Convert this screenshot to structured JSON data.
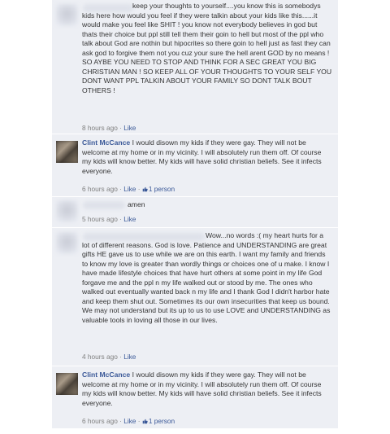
{
  "comments": [
    {
      "author": "",
      "text": "keep your thoughts to yourself....you know this is somebodys kids here how would you feel if they were talkin about your kids like this......it would make you feel like SHIT ! you know not everybody believes in god but thats their choice but ppl still tell them their goin to hell but most of the ppl who talk about God are nothin but hipocrites so there goin to hell just as fast they can ask god to forgive them not you cuz your sure the hell arent GOD by no means ! SO AYBE YOU NEED TO STOP AND THINK FOR A SEC GREAT YOU BIG CHRISTIAN MAN ! SO KEEP ALL OF YOUR THOUGHTS TO YOUR SELF YOU DONT WANT PPL TALKIN ABOUT YOUR FAMILY SO DONT TALK BOUT OTHERS !",
      "time": "8 hours ago",
      "like": "Like"
    },
    {
      "author": "Clint McCance",
      "text": "I would disown my kids if they were gay. They will not be welcome at my home or in my vicinity. I will absolutely run them off. Of course my kids will know better. My kids will have solid christian beliefs. See it infects everyone.",
      "time": "6 hours ago",
      "like": "Like",
      "likes_count": "1 person"
    },
    {
      "author": "",
      "text": "amen",
      "time": "5 hours ago",
      "like": "Like"
    },
    {
      "author": "",
      "text": "Wow...no words :( my heart hurts for a lot of different reasons. God is love. Patience and UNDERSTANDING are great gifts HE gave us to use while we are on this earth. I want my family and friends to know my love is greater than wordly things or choices one of u make. I know I have made lifestyle choices that have hurt others at some point in my life God forgave me and the ppl n my life walked out or stood by me. The ones who walked out eventually wanted back n my life and I thank God I didn't harbor hate and keep them shut out. Sometimes its our own insecurities that keep us bound. We may not understand but its up to us to use LOVE and UNDERSTANDING as valuable tools in loving all those in our lives.",
      "time": "4 hours ago",
      "like": "Like"
    },
    {
      "author": "Clint McCance",
      "text": "I would disown my kids if they were gay. They will not be welcome at my home or in my vicinity. I will absolutely run them off. Of course my kids will know better. My kids will have solid christian beliefs. See it infects everyone.",
      "time": "6 hours ago",
      "like": "Like",
      "likes_count": "1 person"
    }
  ],
  "separator": " · ",
  "colors": {
    "link": "#3b5998",
    "bg": "#edeff4",
    "text": "#333333",
    "meta": "#808080"
  }
}
